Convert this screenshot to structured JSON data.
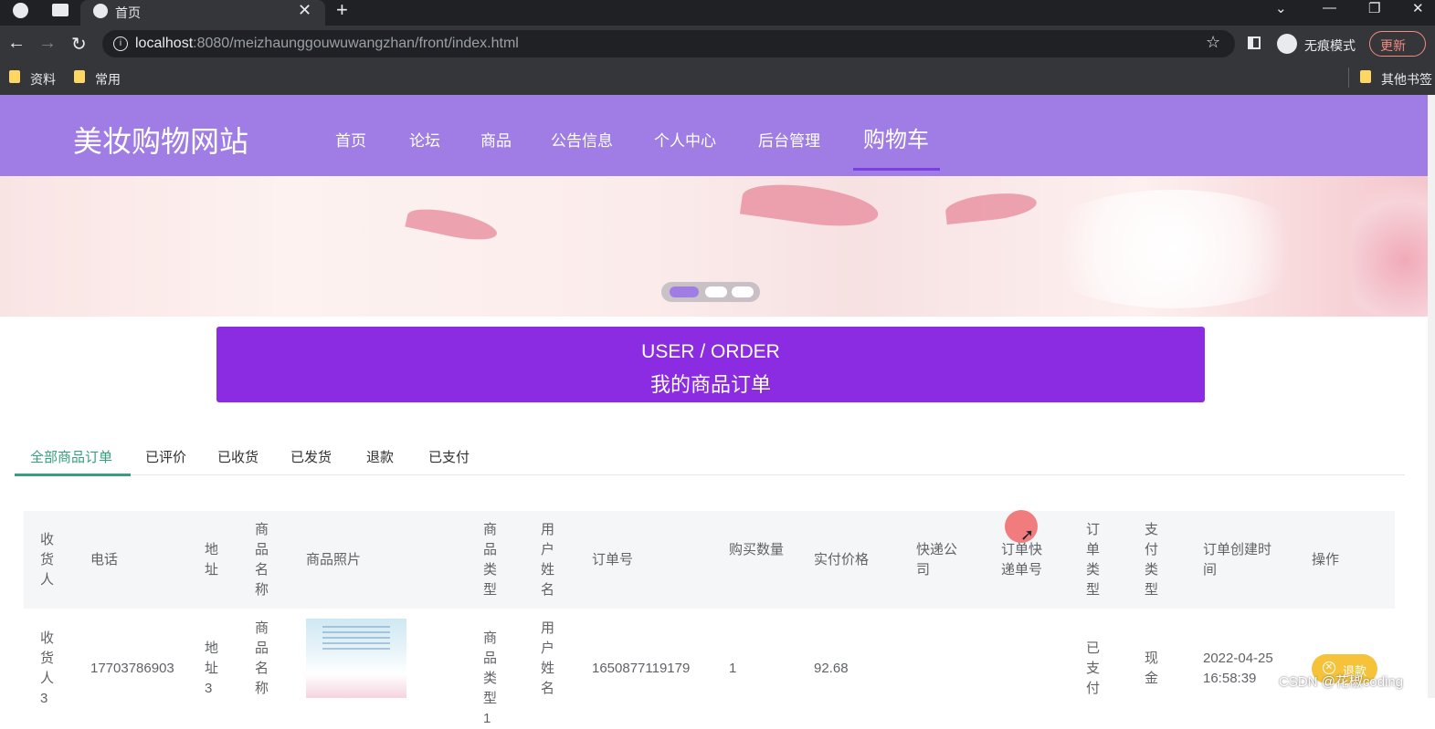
{
  "browser": {
    "tab_title": "首页",
    "tab_close": "✕",
    "new_tab": "+",
    "url_host": "localhost",
    "url_rest": ":8080/meizhaunggouwuwangzhan/front/index.html",
    "incognito_label": "无痕模式",
    "update_label": "更新",
    "bookmarks": [
      "资料",
      "常用"
    ],
    "other_bookmarks": "其他书签"
  },
  "site": {
    "logo": "美妆购物网站",
    "nav": [
      "首页",
      "论坛",
      "商品",
      "公告信息",
      "个人中心",
      "后台管理"
    ],
    "nav_active": "购物车"
  },
  "order_header": {
    "title_en": "USER / ORDER",
    "title_cn": "我的商品订单"
  },
  "tabs": [
    "全部商品订单",
    "已评价",
    "已收货",
    "已发货",
    "退款",
    "已支付"
  ],
  "active_tab": "全部商品订单",
  "table": {
    "headers": [
      "收货人",
      "电话",
      "地址",
      "商品名称",
      "商品照片",
      "商品类型",
      "用户姓名",
      "订单号",
      "购买数量",
      "实付价格",
      "快递公司",
      "订单快递单号",
      "订单类型",
      "支付类型",
      "订单创建时间",
      "操作"
    ],
    "row": {
      "consignee": "收货人3",
      "phone": "17703786903",
      "address": "地址3",
      "product_name": "商品名称",
      "product_type": "商品类型1",
      "user_name": "用户姓名",
      "order_no": "1650877119179",
      "quantity": "1",
      "price": "92.68",
      "courier": "",
      "tracking_no": "",
      "order_type": "已支付",
      "pay_type": "现金",
      "created_date": "2022-04-25",
      "created_time": "16:58:39",
      "action": "退款"
    }
  },
  "watermark": "CSDN @花椒coding",
  "colors": {
    "header": "#9f7de4",
    "title_bar": "#8b2be2",
    "tab_active": "#35a07a",
    "refund_button": "#f5c23a"
  }
}
